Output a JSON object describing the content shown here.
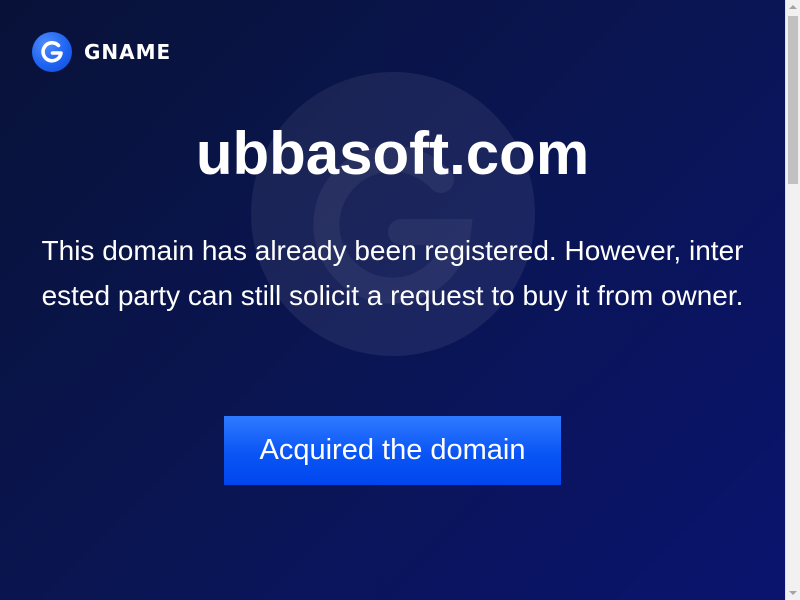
{
  "brand": {
    "name": "GNAME",
    "logo_icon": "gname-g-logo-icon",
    "accent_color": "#1f63f2"
  },
  "main": {
    "domain": "ubbasoft.com",
    "message": "This domain has already been registered. However, interested party can still solicit a request to buy it from owner.",
    "cta_label": "Acquired the domain"
  },
  "scrollbar": {
    "up_icon": "scroll-up-arrow-icon",
    "down_icon": "scroll-down-arrow-icon"
  }
}
